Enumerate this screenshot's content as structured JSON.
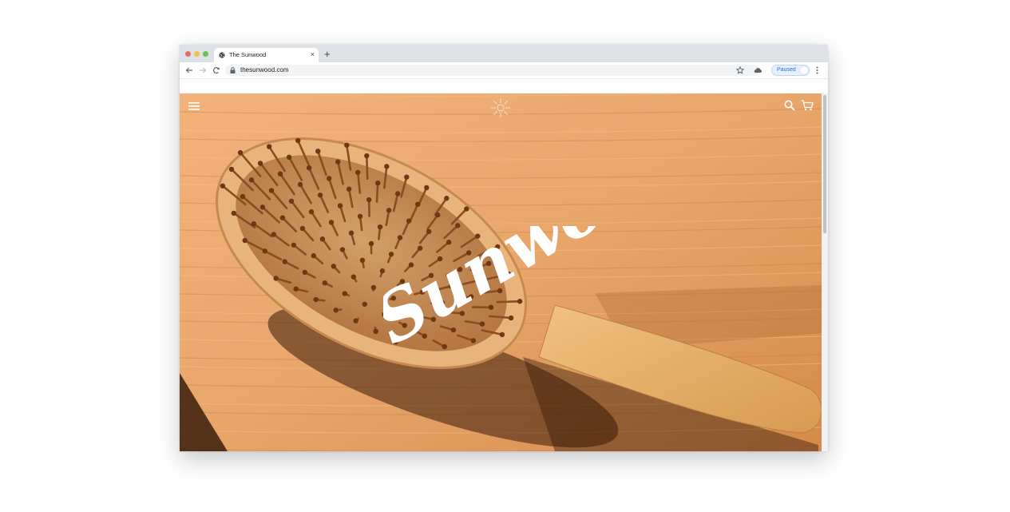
{
  "browser": {
    "tab_title": "The Sunwood",
    "new_tab_label": "+",
    "close_label": "×",
    "url": "thesunwood.com",
    "profile_status": "Paused"
  },
  "site": {
    "wordmark": "Sunwood",
    "icons": [
      "hamburger-icon",
      "logo-icon",
      "search-icon",
      "cart-icon"
    ]
  },
  "colors": {
    "wood_light": "#e8a66a",
    "wood_mid": "#d48a4a",
    "bristle": "#8a4d22",
    "accent_blue": "#1a73e8"
  }
}
